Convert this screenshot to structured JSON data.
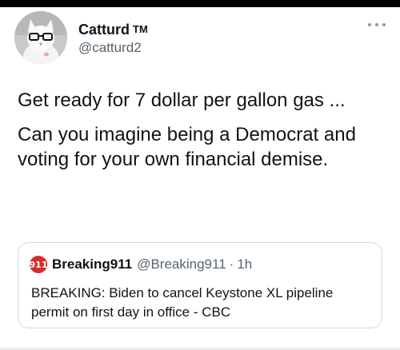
{
  "author": {
    "display_name": "Catturd",
    "badge": "TM",
    "handle": "@catturd2",
    "avatar_icon": "cat-with-glasses-avatar"
  },
  "more_icon": "ellipsis-icon",
  "tweet": {
    "line1": "Get ready for 7 dollar per gallon gas ...",
    "line2": "Can you imagine being a Democrat and voting for your own financial demise."
  },
  "quote": {
    "avatar_text": "911",
    "name": "Breaking911",
    "handle": "@Breaking911",
    "separator": "·",
    "time": "1h",
    "text": "BREAKING: Biden to cancel Keystone XL pipeline permit on first day in office - CBC"
  },
  "colors": {
    "text": "#0f1419",
    "secondary_text": "#536471",
    "border": "#cfd9de",
    "quote_avatar": "#d92b2b"
  }
}
